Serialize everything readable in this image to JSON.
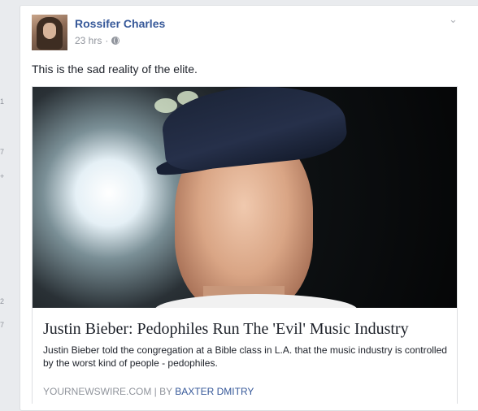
{
  "left_edge": {
    "marks": [
      "1",
      "7",
      "+",
      "2",
      "7"
    ]
  },
  "post": {
    "author": "Rossifer Charles",
    "time": "23 hrs",
    "separator": "·",
    "text": "This is the sad reality of the elite.",
    "menu_icon": "chevron-down-icon"
  },
  "share": {
    "title": "Justin Bieber: Pedophiles Run The 'Evil' Music Industry",
    "description": "Justin Bieber told the congregation at a Bible class in L.A. that the music industry is controlled by the worst kind of people - pedophiles.",
    "source": "YOURNEWSWIRE.COM",
    "divider": " | BY ",
    "author": "BAXTER DMITRY"
  }
}
